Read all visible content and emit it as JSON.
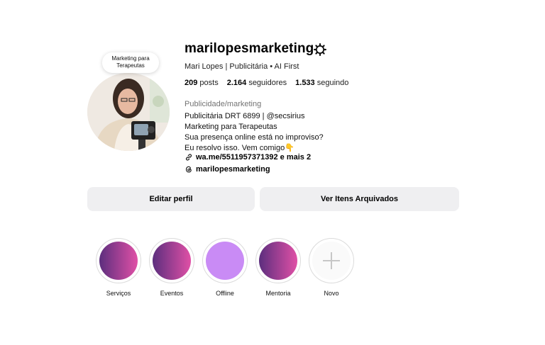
{
  "profile": {
    "note": "Marketing para Terapeutas",
    "username": "marilopesmarketing",
    "full_name": "Mari Lopes | Publicitária • AI First",
    "stats": {
      "posts_count": "209",
      "posts_label": "posts",
      "followers_count": "2.164",
      "followers_label": "seguidores",
      "following_count": "1.533",
      "following_label": "seguindo"
    },
    "category": "Publicidade/marketing",
    "bio": [
      "Publicitária DRT 6899 | @secsirius",
      "Marketing para Terapeutas",
      "Sua presença online está no improviso?",
      "Eu resolvo isso. Vem comigo👇"
    ],
    "link": "wa.me/5511957371392 e mais 2",
    "threads": "marilopesmarketing"
  },
  "actions": {
    "edit_profile": "Editar perfil",
    "view_archived": "Ver Itens Arquivados"
  },
  "highlights": [
    {
      "label": "Serviços",
      "style": "gradient"
    },
    {
      "label": "Eventos",
      "style": "gradient"
    },
    {
      "label": "Offline",
      "style": "solid"
    },
    {
      "label": "Mentoria",
      "style": "gradient"
    },
    {
      "label": "Novo",
      "style": "new"
    }
  ],
  "colors": {
    "gradient_start": "#5c2e7e",
    "gradient_end": "#e050a6",
    "offline_fill": "#c98bf5",
    "button_bg": "#efeff1",
    "muted_text": "#737373"
  },
  "icons": {
    "settings": "gear-icon",
    "link": "link-icon",
    "threads": "threads-icon",
    "new_highlight": "plus-icon"
  }
}
